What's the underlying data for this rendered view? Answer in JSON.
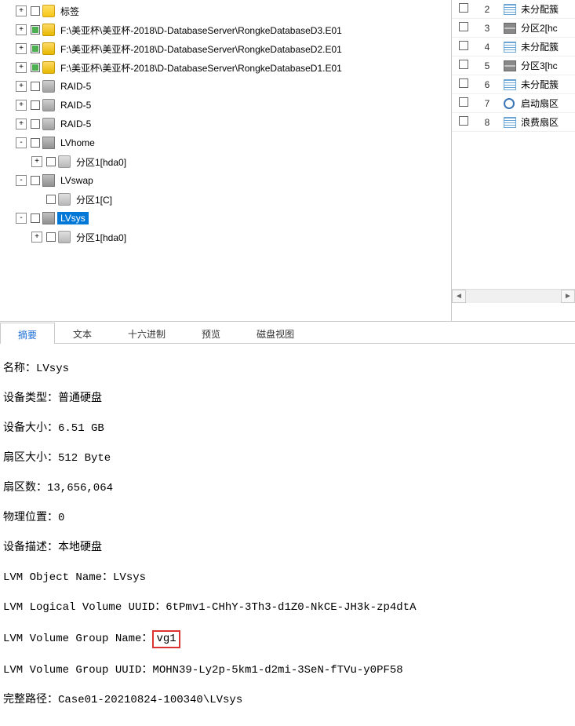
{
  "tree": {
    "items": [
      {
        "level": 1,
        "toggle": "+",
        "icon": "tag",
        "label": "标签"
      },
      {
        "level": 1,
        "toggle": "+",
        "green": true,
        "icon": "lock",
        "label": "F:\\美亚杯\\美亚杯-2018\\D-DatabaseServer\\RongkeDatabaseD3.E01"
      },
      {
        "level": 1,
        "toggle": "+",
        "green": true,
        "icon": "lock",
        "label": "F:\\美亚杯\\美亚杯-2018\\D-DatabaseServer\\RongkeDatabaseD2.E01"
      },
      {
        "level": 1,
        "toggle": "+",
        "green": true,
        "icon": "lock",
        "label": "F:\\美亚杯\\美亚杯-2018\\D-DatabaseServer\\RongkeDatabaseD1.E01"
      },
      {
        "level": 1,
        "toggle": "+",
        "icon": "raid",
        "label": "RAID-5"
      },
      {
        "level": 1,
        "toggle": "+",
        "icon": "raid",
        "label": "RAID-5"
      },
      {
        "level": 1,
        "toggle": "+",
        "icon": "raid",
        "label": "RAID-5"
      },
      {
        "level": 1,
        "toggle": "-",
        "icon": "lv",
        "label": "LVhome"
      },
      {
        "level": 2,
        "toggle": "+",
        "icon": "part",
        "label": "分区1[hda0]"
      },
      {
        "level": 1,
        "toggle": "-",
        "icon": "lv",
        "label": "LVswap"
      },
      {
        "level": 2,
        "toggle": "",
        "icon": "part",
        "label": "分区1[C]"
      },
      {
        "level": 1,
        "toggle": "-",
        "icon": "lv",
        "label": "LVsys",
        "selected": true
      },
      {
        "level": 2,
        "toggle": "+",
        "icon": "part",
        "label": "分区1[hda0]"
      }
    ]
  },
  "grid": {
    "rows": [
      {
        "n": "2",
        "icon": "lines",
        "text": "未分配簇"
      },
      {
        "n": "3",
        "icon": "bars",
        "text": "分区2[hc"
      },
      {
        "n": "4",
        "icon": "lines",
        "text": "未分配簇"
      },
      {
        "n": "5",
        "icon": "bars",
        "text": "分区3[hc"
      },
      {
        "n": "6",
        "icon": "lines",
        "text": "未分配簇"
      },
      {
        "n": "7",
        "icon": "ring",
        "text": "启动扇区"
      },
      {
        "n": "8",
        "icon": "lines",
        "text": "浪费扇区"
      }
    ]
  },
  "tabs": {
    "t0": "摘要",
    "t1": "文本",
    "t2": "十六进制",
    "t3": "预览",
    "t4": "磁盘视图"
  },
  "details": {
    "l0": "名称：LVsys",
    "l1": "设备类型：普通硬盘",
    "l2": "设备大小：6.51 GB",
    "l3": "扇区大小：512 Byte",
    "l4": "扇区数：13,656,064",
    "l5": "物理位置：0",
    "l6": "设备描述：本地硬盘",
    "l7": "LVM Object Name：LVsys",
    "l8": "LVM Logical Volume UUID：6tPmv1-CHhY-3Th3-d1Z0-NkCE-JH3k-zp4dtA",
    "l9a": "LVM Volume Group Name：",
    "l9b": "vg1",
    "l10": "LVM Volume Group UUID：MOHN39-Ly2p-5km1-d2mi-3SeN-fTVu-y0PF58",
    "l11": "完整路径：Case01-20210824-100340\\LVsys"
  }
}
